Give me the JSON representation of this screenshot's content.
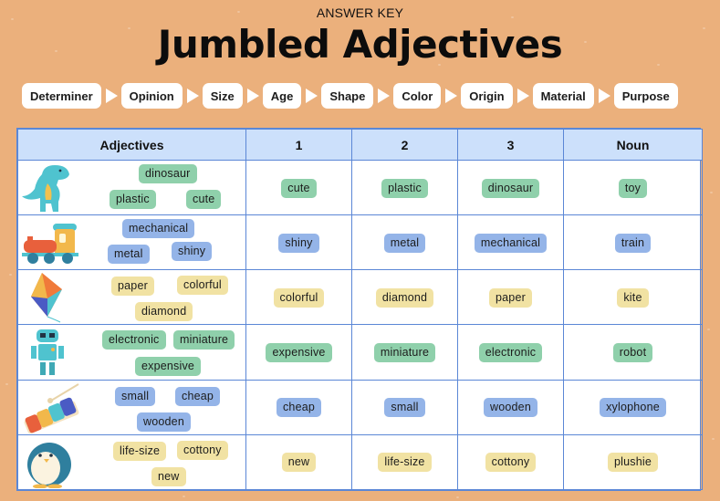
{
  "header": {
    "kicker": "ANSWER KEY",
    "title": "Jumbled Adjectives"
  },
  "order": [
    "Determiner",
    "Opinion",
    "Size",
    "Age",
    "Shape",
    "Color",
    "Origin",
    "Material",
    "Purpose"
  ],
  "table": {
    "headers": [
      "Adjectives",
      "1",
      "2",
      "3",
      "Noun"
    ],
    "rows": [
      {
        "picture": "dinosaur-toy-icon",
        "color": "green",
        "jumbled": [
          "dinosaur",
          "plastic",
          "cute"
        ],
        "answer": [
          "cute",
          "plastic",
          "dinosaur",
          "toy"
        ]
      },
      {
        "picture": "toy-train-icon",
        "color": "blue",
        "jumbled": [
          "mechanical",
          "metal",
          "shiny"
        ],
        "answer": [
          "shiny",
          "metal",
          "mechanical",
          "train"
        ]
      },
      {
        "picture": "kite-icon",
        "color": "yellow",
        "jumbled": [
          "paper",
          "colorful",
          "diamond"
        ],
        "answer": [
          "colorful",
          "diamond",
          "paper",
          "kite"
        ]
      },
      {
        "picture": "robot-icon",
        "color": "green",
        "jumbled": [
          "electronic",
          "miniature",
          "expensive"
        ],
        "answer": [
          "expensive",
          "miniature",
          "electronic",
          "robot"
        ]
      },
      {
        "picture": "xylophone-icon",
        "color": "blue",
        "jumbled": [
          "small",
          "cheap",
          "wooden"
        ],
        "answer": [
          "cheap",
          "small",
          "wooden",
          "xylophone"
        ]
      },
      {
        "picture": "penguin-plushie-icon",
        "color": "yellow",
        "jumbled": [
          "life-size",
          "cottony",
          "new"
        ],
        "answer": [
          "new",
          "life-size",
          "cottony",
          "plushie"
        ]
      }
    ]
  },
  "colors": {
    "background": "#ebb07c",
    "header_row": "#cce0fb",
    "grid": "#5b87d6",
    "green_tag": "#8fd0ab",
    "blue_tag": "#94b4e8",
    "yellow_tag": "#f1e2a3"
  }
}
